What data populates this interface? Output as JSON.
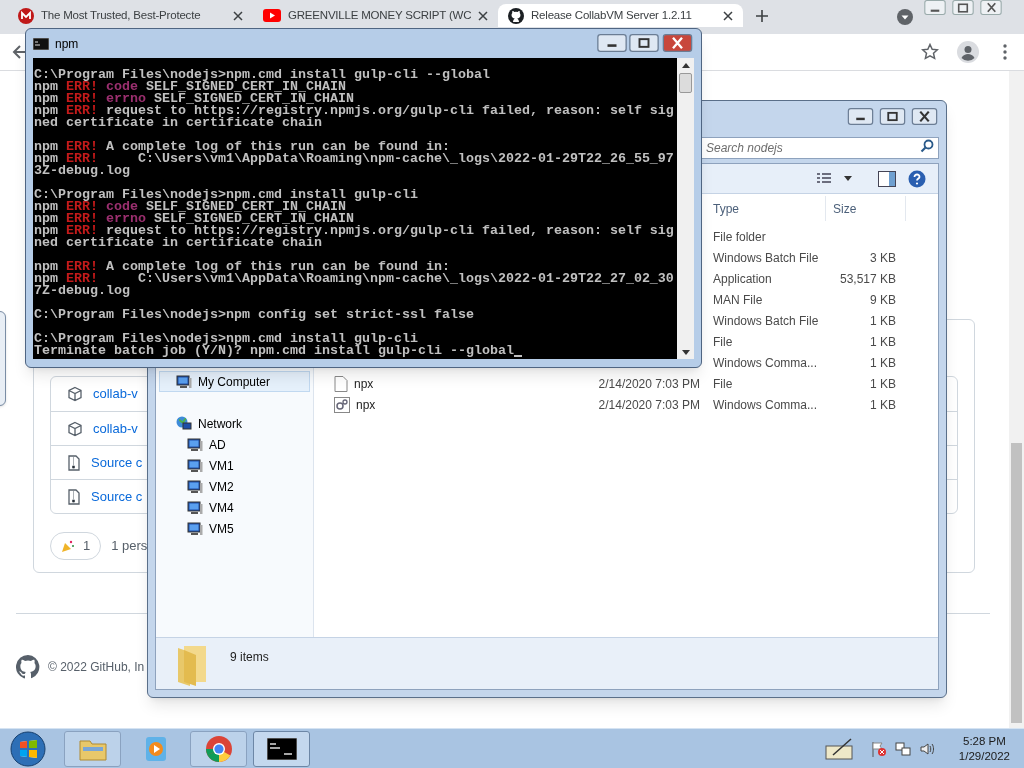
{
  "browser": {
    "tabs": [
      {
        "title": "The Most Trusted, Best-Protecte",
        "selected": false
      },
      {
        "title": "GREENVILLE MONEY SCRIPT (WC",
        "selected": false
      },
      {
        "title": "Release CollabVM Server 1.2.11",
        "selected": true
      }
    ]
  },
  "github": {
    "assets": [
      {
        "kind": "package",
        "label": "collab-v"
      },
      {
        "kind": "package",
        "label": "collab-v"
      },
      {
        "kind": "archive",
        "label": "Source c"
      },
      {
        "kind": "archive",
        "label": "Source c"
      }
    ],
    "reaction": {
      "count": "1",
      "summary": "1 pers"
    },
    "footer": "© 2022 GitHub, In"
  },
  "console": {
    "title": "npm",
    "blocks": [
      {
        "lines": [
          {
            "segments": [
              {
                "kind": "plain",
                "text": "C:\\Program Files\\nodejs>npm.cmd install gulp-cli --global"
              }
            ]
          },
          {
            "segments": [
              {
                "kind": "plain",
                "text": "npm "
              },
              {
                "kind": "error",
                "text": "ERR!"
              },
              {
                "kind": "key",
                "text": " code"
              },
              {
                "kind": "plain",
                "text": " SELF_SIGNED_CERT_IN_CHAIN"
              }
            ]
          },
          {
            "segments": [
              {
                "kind": "plain",
                "text": "npm "
              },
              {
                "kind": "error",
                "text": "ERR!"
              },
              {
                "kind": "key",
                "text": " errno"
              },
              {
                "kind": "plain",
                "text": " SELF_SIGNED_CERT_IN_CHAIN"
              }
            ]
          },
          {
            "segments": [
              {
                "kind": "plain",
                "text": "npm "
              },
              {
                "kind": "error",
                "text": "ERR!"
              },
              {
                "kind": "plain",
                "text": " request to https://registry.npmjs.org/gulp-cli failed, reason: self sig"
              }
            ]
          },
          {
            "segments": [
              {
                "kind": "plain",
                "text": "ned certificate in certificate chain"
              }
            ]
          }
        ]
      },
      {
        "lines": [
          {
            "segments": [
              {
                "kind": "plain",
                "text": "npm "
              },
              {
                "kind": "error",
                "text": "ERR!"
              },
              {
                "kind": "plain",
                "text": " A complete log of this run can be found in:"
              }
            ]
          },
          {
            "segments": [
              {
                "kind": "plain",
                "text": "npm "
              },
              {
                "kind": "error",
                "text": "ERR!"
              },
              {
                "kind": "plain",
                "text": "     C:\\Users\\vm1\\AppData\\Roaming\\npm-cache\\_logs\\2022-01-29T22_26_55_97"
              }
            ]
          },
          {
            "segments": [
              {
                "kind": "plain",
                "text": "3Z-debug.log"
              }
            ]
          }
        ]
      },
      {
        "lines": [
          {
            "segments": [
              {
                "kind": "plain",
                "text": "C:\\Program Files\\nodejs>npm.cmd install gulp-cli"
              }
            ]
          },
          {
            "segments": [
              {
                "kind": "plain",
                "text": "npm "
              },
              {
                "kind": "error",
                "text": "ERR!"
              },
              {
                "kind": "key",
                "text": " code"
              },
              {
                "kind": "plain",
                "text": " SELF_SIGNED_CERT_IN_CHAIN"
              }
            ]
          },
          {
            "segments": [
              {
                "kind": "plain",
                "text": "npm "
              },
              {
                "kind": "error",
                "text": "ERR!"
              },
              {
                "kind": "key",
                "text": " errno"
              },
              {
                "kind": "plain",
                "text": " SELF_SIGNED_CERT_IN_CHAIN"
              }
            ]
          },
          {
            "segments": [
              {
                "kind": "plain",
                "text": "npm "
              },
              {
                "kind": "error",
                "text": "ERR!"
              },
              {
                "kind": "plain",
                "text": " request to https://registry.npmjs.org/gulp-cli failed, reason: self sig"
              }
            ]
          },
          {
            "segments": [
              {
                "kind": "plain",
                "text": "ned certificate in certificate chain"
              }
            ]
          }
        ]
      },
      {
        "lines": [
          {
            "segments": [
              {
                "kind": "plain",
                "text": "npm "
              },
              {
                "kind": "error",
                "text": "ERR!"
              },
              {
                "kind": "plain",
                "text": " A complete log of this run can be found in:"
              }
            ]
          },
          {
            "segments": [
              {
                "kind": "plain",
                "text": "npm "
              },
              {
                "kind": "error",
                "text": "ERR!"
              },
              {
                "kind": "plain",
                "text": "     C:\\Users\\vm1\\AppData\\Roaming\\npm-cache\\_logs\\2022-01-29T22_27_02_30"
              }
            ]
          },
          {
            "segments": [
              {
                "kind": "plain",
                "text": "7Z-debug.log"
              }
            ]
          }
        ]
      },
      {
        "lines": [
          {
            "segments": [
              {
                "kind": "plain",
                "text": "C:\\Program Files\\nodejs>npm config set strict-ssl false"
              }
            ]
          }
        ]
      },
      {
        "lines": [
          {
            "segments": [
              {
                "kind": "plain",
                "text": "C:\\Program Files\\nodejs>npm.cmd install gulp-cli"
              }
            ]
          },
          {
            "segments": [
              {
                "kind": "plain",
                "text": "Terminate batch job (Y/N)? npm.cmd install gulp-cli --global"
              }
            ]
          }
        ]
      }
    ]
  },
  "explorer": {
    "search": {
      "placeholder": "Search nodejs"
    },
    "columns": [
      "Type",
      "Size"
    ],
    "nav": [
      {
        "label": "My Computer",
        "selected": true
      },
      {
        "label": "Network",
        "selected": false,
        "children": [
          {
            "label": "AD",
            "selected": false
          },
          {
            "label": "VM1",
            "selected": false
          },
          {
            "label": "VM2",
            "selected": false
          },
          {
            "label": "VM4",
            "selected": false
          },
          {
            "label": "VM5",
            "selected": false
          }
        ]
      }
    ],
    "files": [
      {
        "type": "File folder"
      },
      {
        "type": "Windows Batch File",
        "size": "3 KB"
      },
      {
        "type": "Application",
        "size": "53,517 KB"
      },
      {
        "type": "MAN File",
        "size": "9 KB"
      },
      {
        "type": "Windows Batch File",
        "size": "1 KB"
      },
      {
        "type": "File",
        "size": "1 KB"
      },
      {
        "type": "Windows Comma...",
        "size": "1 KB"
      },
      {
        "kind": "file",
        "name": "npx",
        "date": "2/14/2020 7:03 PM",
        "type": "File",
        "size": "1 KB"
      },
      {
        "kind": "script",
        "name": "npx",
        "date": "2/14/2020 7:03 PM",
        "type": "Windows Comma...",
        "size": "1 KB"
      }
    ],
    "status": "9 items"
  },
  "taskbar": {
    "time": "5:28 PM",
    "date": "1/29/2022"
  }
}
